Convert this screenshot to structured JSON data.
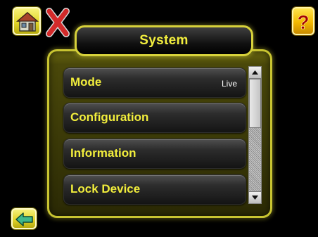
{
  "header": {
    "title": "System"
  },
  "toolbar": {
    "home_icon": "home-icon",
    "close_icon": "close-icon",
    "help_icon": "help-icon",
    "back_icon": "back-arrow-icon"
  },
  "menu": {
    "items": [
      {
        "label": "Mode",
        "value": "Live"
      },
      {
        "label": "Configuration",
        "value": ""
      },
      {
        "label": "Information",
        "value": ""
      },
      {
        "label": "Lock Device",
        "value": ""
      }
    ]
  },
  "colors": {
    "accent_yellow": "#f2ee3c",
    "panel_border": "#c8c431",
    "background": "#000000"
  }
}
